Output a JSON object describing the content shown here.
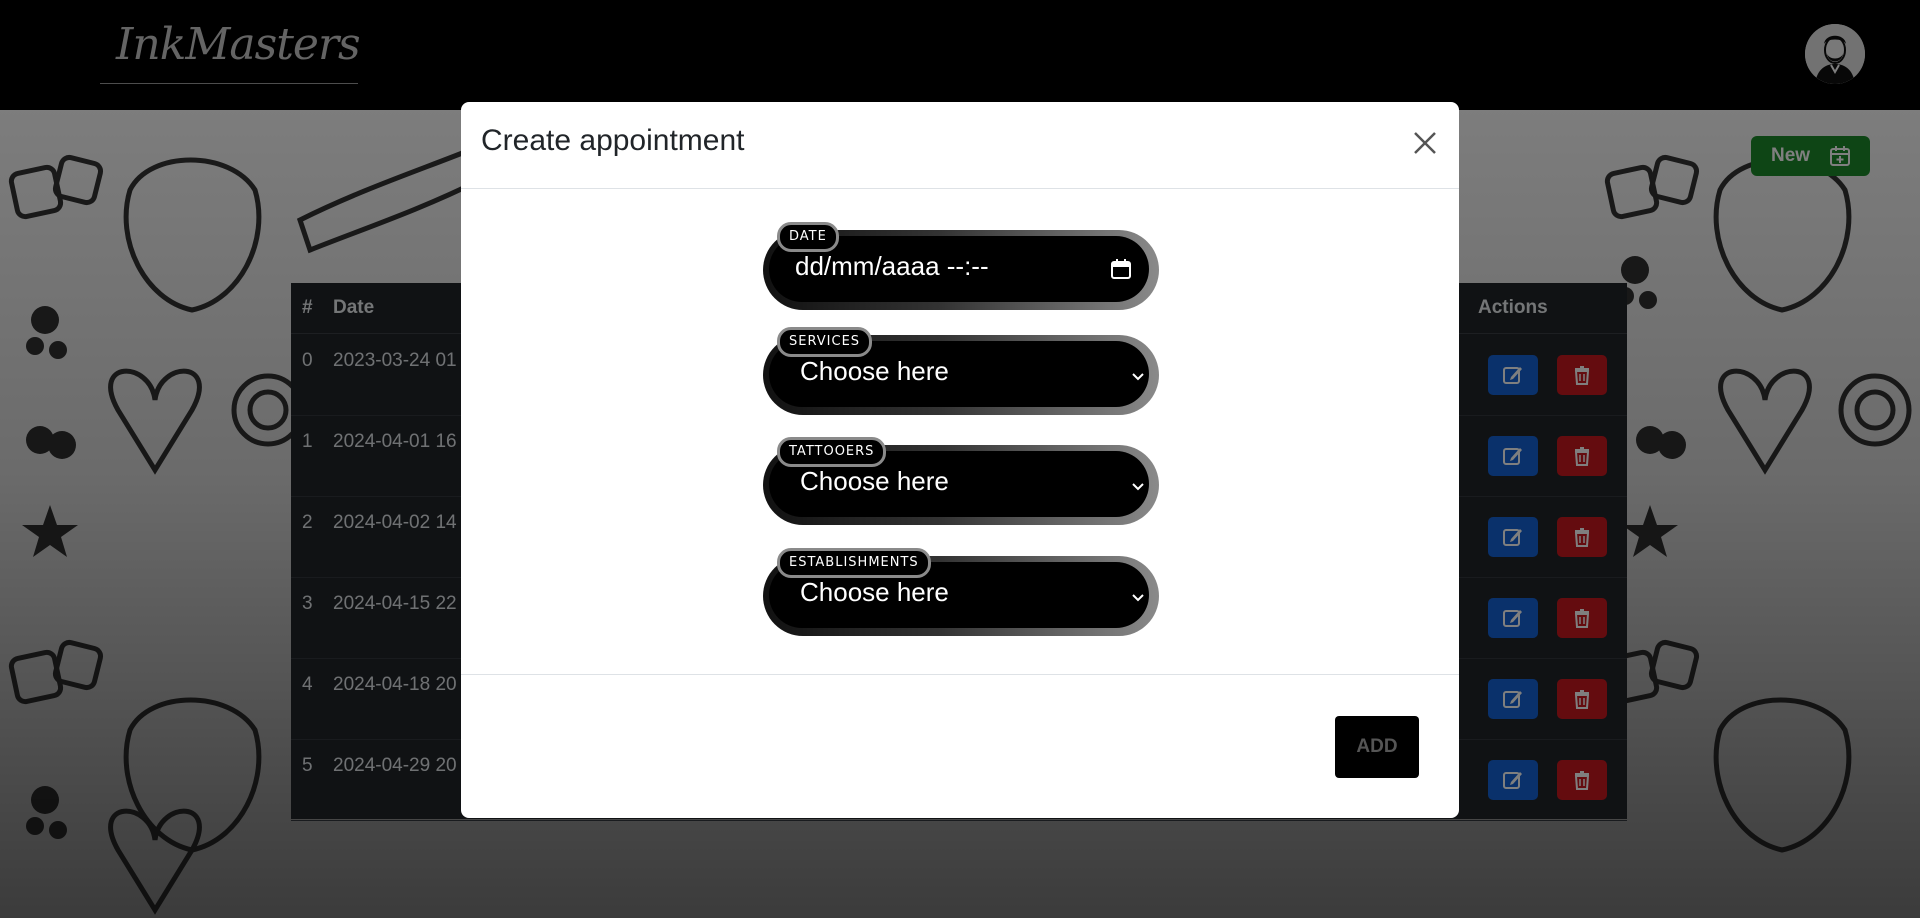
{
  "app": {
    "logo_text": "InkMasters"
  },
  "toolbar": {
    "new_label": "New"
  },
  "table": {
    "headers": {
      "index": "#",
      "date": "Date",
      "actions": "Actions"
    },
    "rows": [
      {
        "index": "0",
        "date": "2023-03-24 01"
      },
      {
        "index": "1",
        "date": "2024-04-01 16"
      },
      {
        "index": "2",
        "date": "2024-04-02 14"
      },
      {
        "index": "3",
        "date": "2024-04-15 22"
      },
      {
        "index": "4",
        "date": "2024-04-18 20"
      },
      {
        "index": "5",
        "date": "2024-04-29 20"
      }
    ]
  },
  "modal": {
    "title": "Create appointment",
    "fields": {
      "date": {
        "label": "DATE",
        "value": "dd/mm/aaaa --:--"
      },
      "services": {
        "label": "SERVICES",
        "value": "Choose here"
      },
      "tattooers": {
        "label": "TATTOOERS",
        "value": "Choose here"
      },
      "establishments": {
        "label": "ESTABLISHMENTS",
        "value": "Choose here"
      }
    },
    "add_label": "ADD"
  },
  "colors": {
    "new_button": "#1d8a2a",
    "edit_button": "#1462d6",
    "delete_button": "#c8181f",
    "table_bg": "#212529",
    "modal_bg": "#ffffff",
    "field_bg": "#000000"
  },
  "icons": {
    "new": "calendar-plus-icon",
    "edit": "edit-icon",
    "delete": "trash-icon",
    "close": "close-icon",
    "calendar": "calendar-icon",
    "dropdown": "chevron-down-icon",
    "avatar": "user-avatar"
  }
}
